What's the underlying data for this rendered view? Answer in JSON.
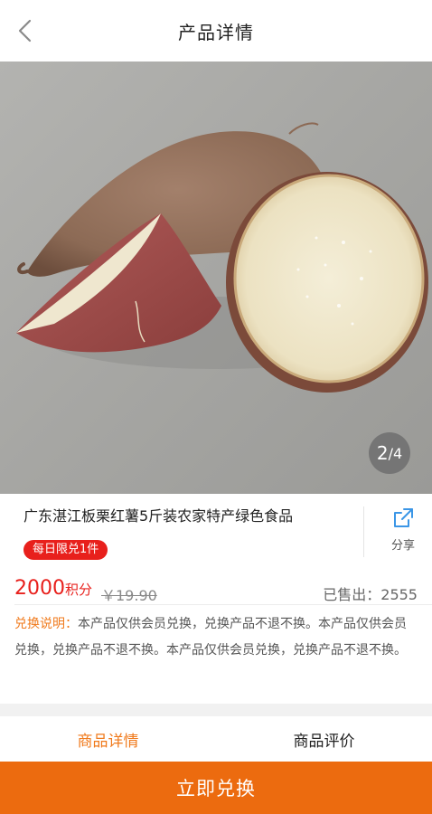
{
  "header": {
    "title": "产品详情",
    "back_icon": "chevron-left-icon"
  },
  "gallery": {
    "current": "2",
    "separator": "/",
    "total": "4"
  },
  "product": {
    "title": "广东湛江板栗红薯5斤装农家特产绿色食品",
    "limit_badge": "每日限兑1件",
    "share_label": "分享",
    "points": "2000",
    "points_unit": "积分",
    "original_price": "￥19.90",
    "sold": "已售出：2555",
    "exchange_label": "兑换说明：",
    "exchange_text": "本产品仅供会员兑换，兑换产品不退不换。本产品仅供会员兑换，兑换产品不退不换。本产品仅供会员兑换，兑换产品不退不换。"
  },
  "tabs": [
    {
      "label": "商品详情",
      "active": true
    },
    {
      "label": "商品评价",
      "active": false
    }
  ],
  "action": {
    "exchange_button": "立即兑换"
  },
  "colors": {
    "accent_orange": "#ec6b0f",
    "price_red": "#e8201c",
    "tab_active": "#f07a1c",
    "share_blue": "#3b96e6"
  }
}
